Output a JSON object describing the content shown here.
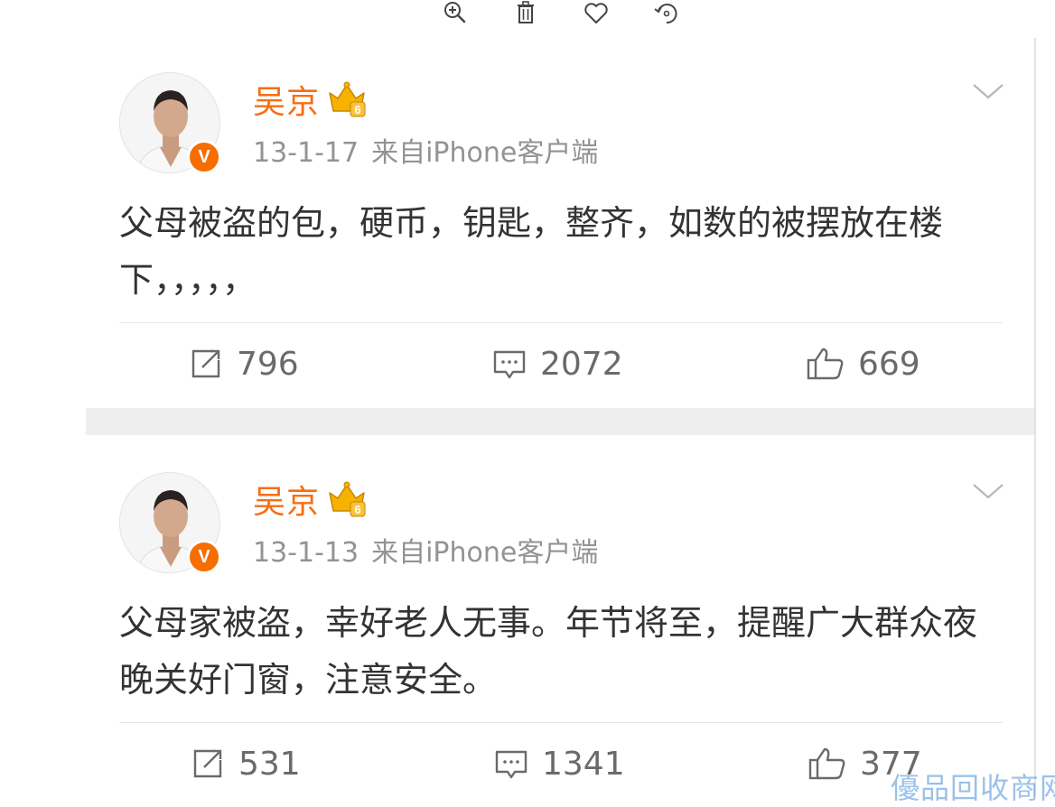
{
  "viewer_toolbar": {
    "items": [
      {
        "icon": "zoom-in-icon"
      },
      {
        "icon": "trash-icon"
      },
      {
        "icon": "heart-icon"
      },
      {
        "icon": "rotate-icon"
      }
    ]
  },
  "posts": [
    {
      "author": "吴京",
      "level_badge": "6",
      "verified_mark": "V",
      "date": "13-1-17",
      "source": "来自iPhone客户端",
      "text": "父母被盗的包，硬币，钥匙，整齐，如数的被摆放在楼下，，，，，",
      "reposts": "796",
      "comments": "2072",
      "likes": "669"
    },
    {
      "author": "吴京",
      "level_badge": "6",
      "verified_mark": "V",
      "date": "13-1-13",
      "source": "来自iPhone客户端",
      "text": "父母家被盗，幸好老人无事。年节将至，提醒广大群众夜晚关好门窗，注意安全。",
      "reposts": "531",
      "comments": "1341",
      "likes": "377"
    }
  ],
  "watermark": "優品回收商网",
  "colors": {
    "author_name": "#f86d10",
    "meta_text": "#939393",
    "body_text": "#333333",
    "count_text": "#6a6a6a",
    "verified_badge": "#f66d00",
    "crown_badge": "#f5b300",
    "separator": "#eeeeee"
  }
}
